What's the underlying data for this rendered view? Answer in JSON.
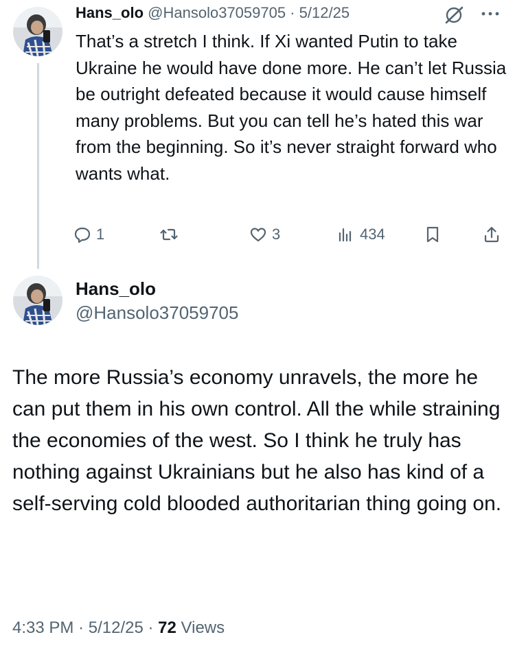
{
  "reply": {
    "name": "Hans_olo",
    "handle": "@Hansolo37059705",
    "separator": "·",
    "date": "5/12/25",
    "text": "That’s a stretch I think. If Xi wanted Putin to take Ukraine he would have done more. He can’t let Russia be outright defeated because it would cause himself many problems. But you can tell he’s hated this war from the beginning. So it’s never straight forward who wants what.",
    "icons": [
      "grok-icon",
      "more-icon"
    ],
    "actions": {
      "reply_count": "1",
      "retweet_count": "",
      "like_count": "3",
      "view_count": "434"
    }
  },
  "main": {
    "name": "Hans_olo",
    "handle": "@Hansolo37059705",
    "text": "The more Russia’s economy unravels, the more he can put them in his own control. All the while straining the economies of the west. So I think he truly has nothing against Ukrainians but he also has kind of a self-serving cold blooded authoritarian thing going on.",
    "time": "4:33 PM",
    "separator": "·",
    "date": "5/12/25",
    "views_count": "72",
    "views_label": "Views"
  },
  "colors": {
    "text": "#0f1419",
    "muted": "#536471",
    "thread_line": "#cfd9de"
  }
}
